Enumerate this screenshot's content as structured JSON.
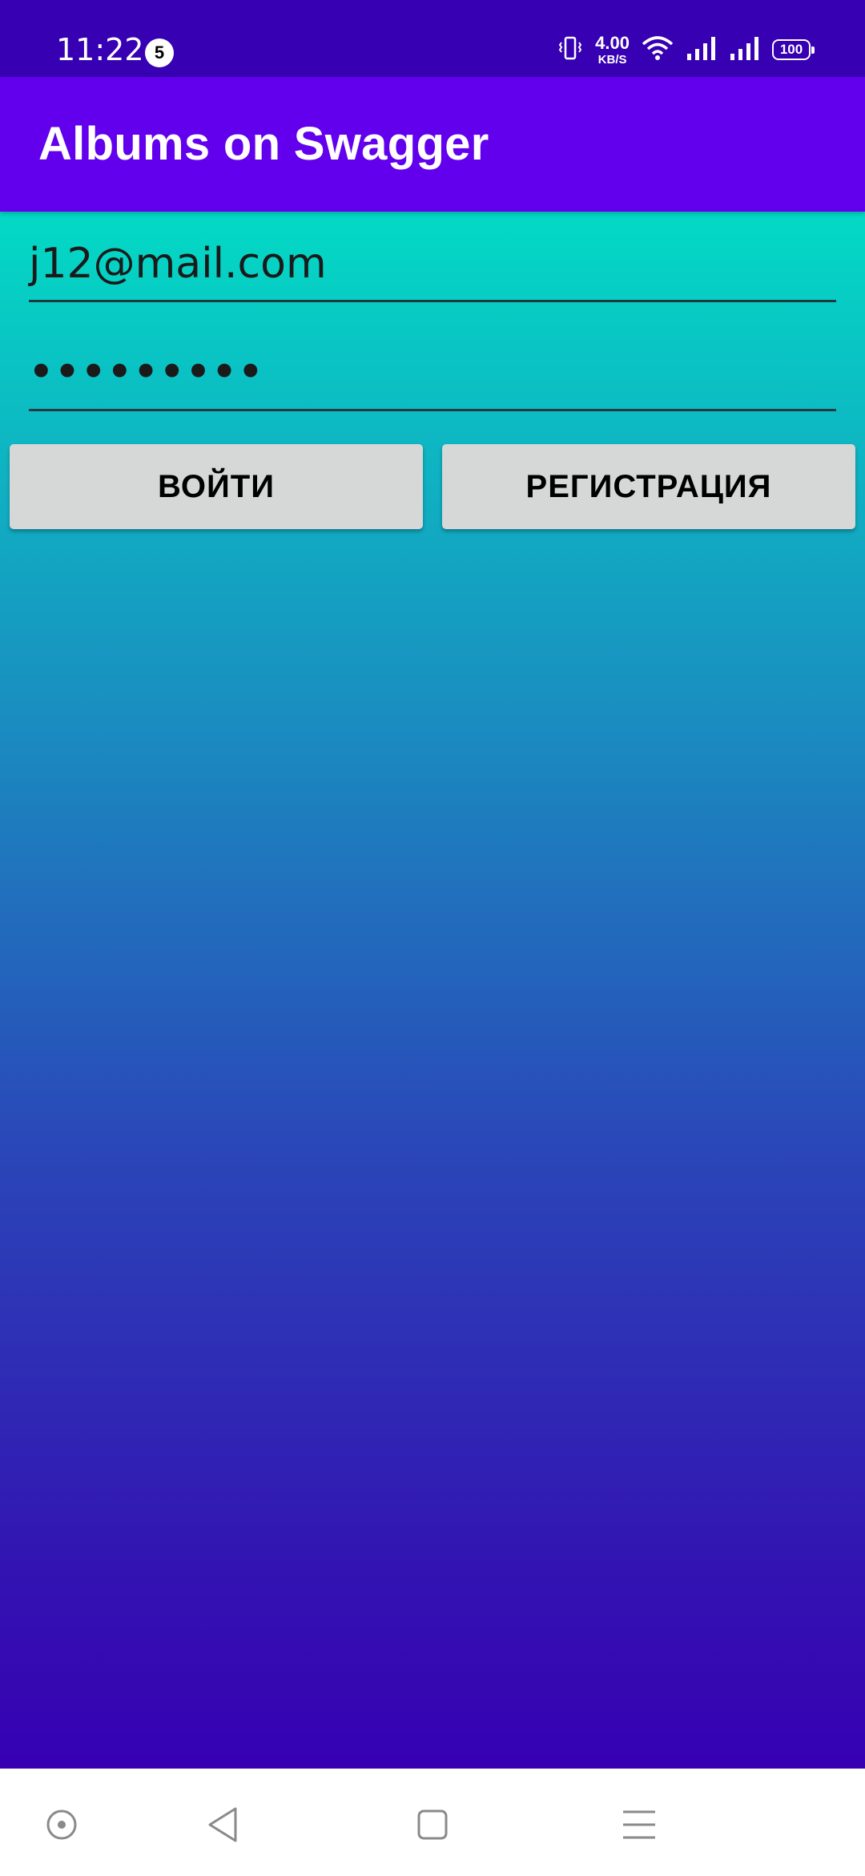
{
  "status_bar": {
    "time": "11:22",
    "notification_count": "5",
    "net_speed": "4.00",
    "net_speed_unit": "KB/S",
    "battery": "100",
    "icons": [
      "vibrate-icon",
      "wifi-icon",
      "signal-icon",
      "signal-icon",
      "battery-icon"
    ]
  },
  "app_bar": {
    "title": "Albums on Swagger",
    "color": "#6200ee"
  },
  "login_form": {
    "email_value": "j12@mail.com",
    "password_value": "•••••••••",
    "login_button": "ВОЙТИ",
    "register_button": "РЕГИСТРАЦИЯ"
  },
  "nav_bar": {
    "icons": [
      "assistant-icon",
      "back-icon",
      "home-icon",
      "menu-icon"
    ]
  },
  "colors": {
    "status_bar": "#3700b3",
    "gradient_top": "#03dac5",
    "gradient_bottom": "#3700b3",
    "button": "#d6d7d7"
  }
}
